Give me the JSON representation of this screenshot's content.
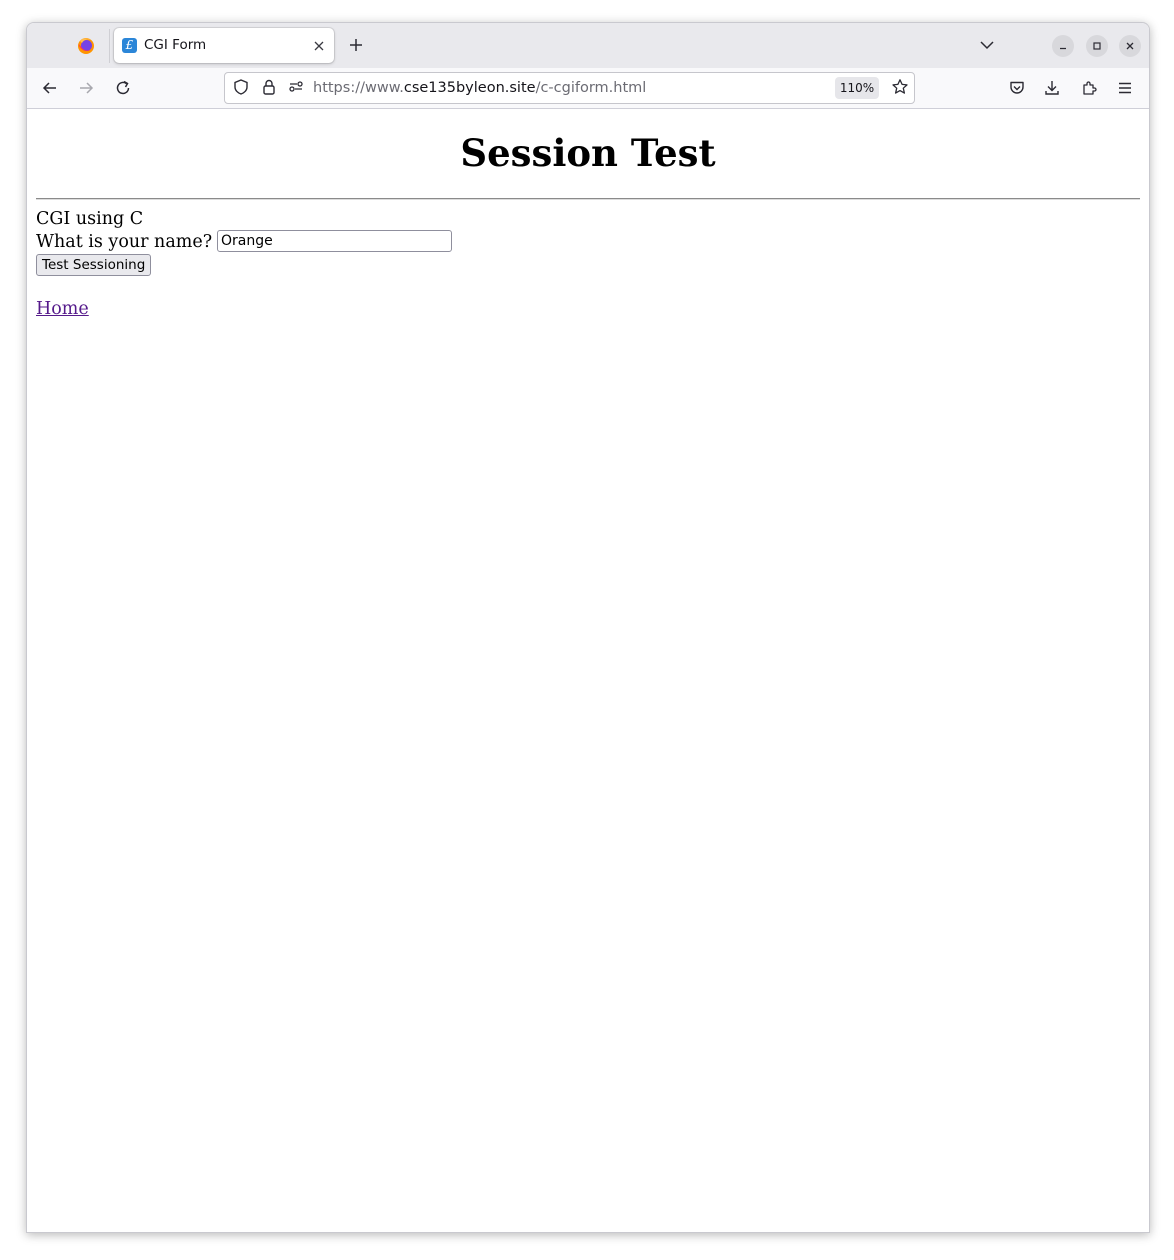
{
  "browser": {
    "tab": {
      "title": "CGI Form",
      "favicon": "£"
    },
    "url": {
      "scheme": "https://www.",
      "host": "cse135byleon.site",
      "path": "/c-cgiform.html"
    },
    "zoom": "110%"
  },
  "page": {
    "heading": "Session Test",
    "subtitle": "CGI using C",
    "name_label": "What is your name?",
    "name_value": "Orange",
    "submit_label": "Test Sessioning",
    "home_link": "Home"
  },
  "colors": {
    "link_visited": "#551a8b",
    "tabstrip_bg": "#e9e9ed",
    "favicon_bg": "#2b86d8"
  }
}
